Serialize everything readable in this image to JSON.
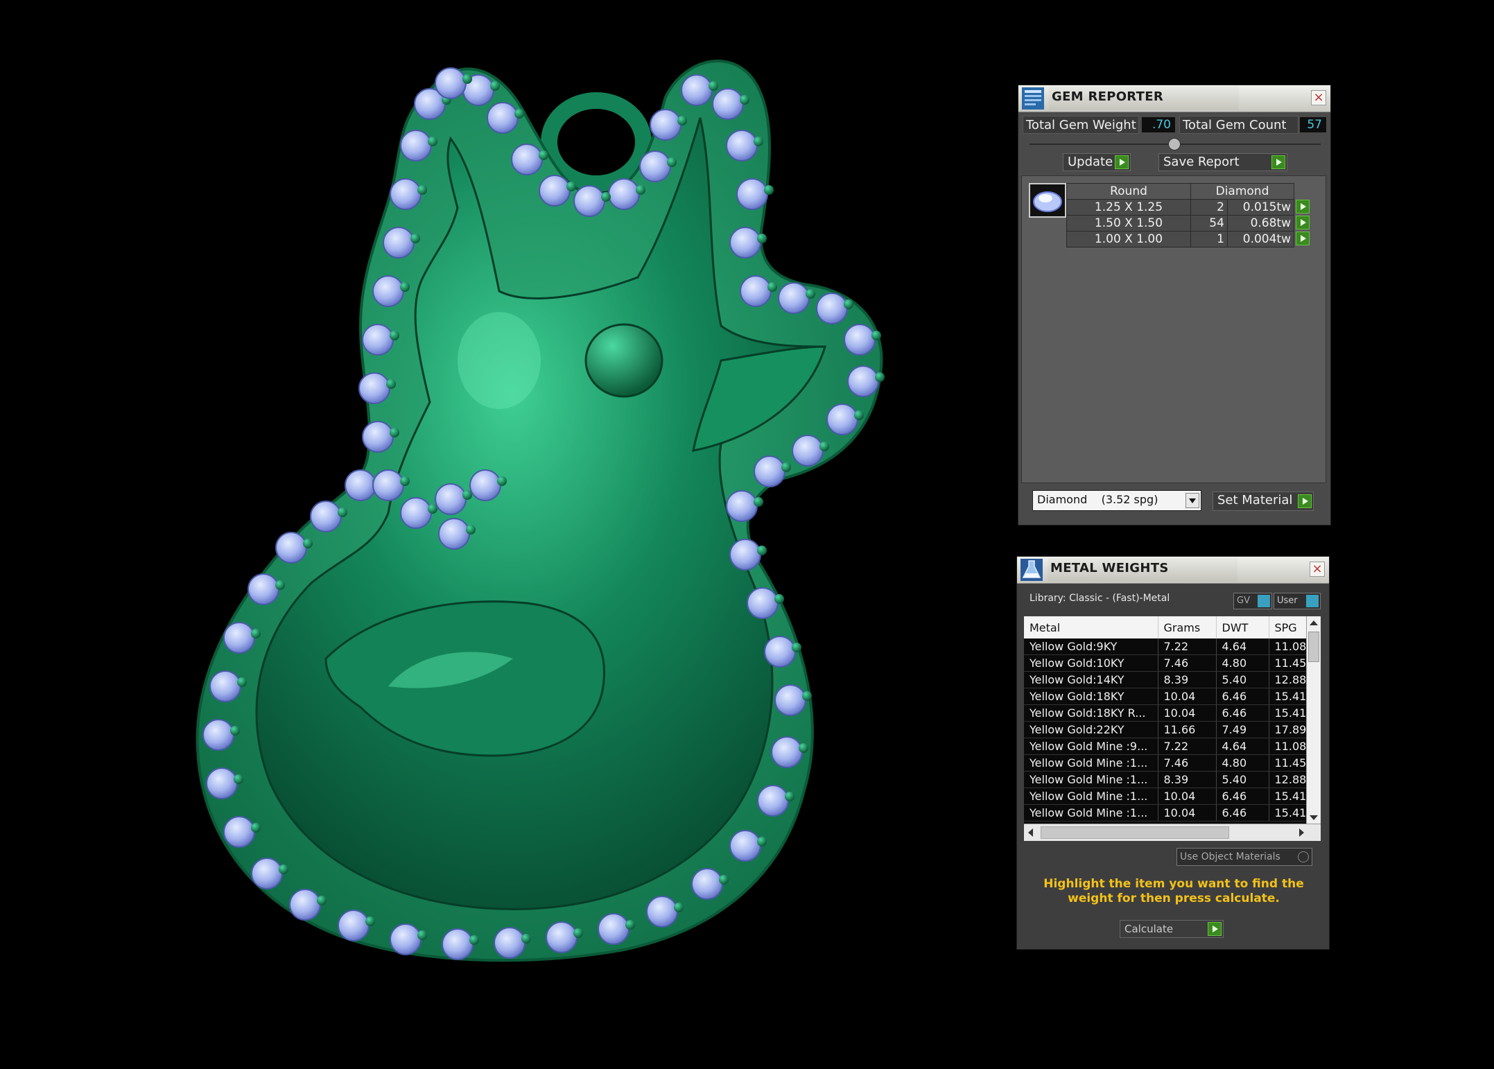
{
  "gem_reporter": {
    "title": "GEM REPORTER",
    "close_label": "×",
    "total_weight_label": "Total Gem Weight",
    "total_weight_value": ".70",
    "total_count_label": "Total Gem Count",
    "total_count_value": "57",
    "update_label": "Update",
    "save_report_label": "Save Report",
    "table": {
      "headers": [
        "Round",
        "Diamond"
      ],
      "rows": [
        {
          "size": "1.25 X 1.25",
          "count": "2",
          "weight": "0.015tw"
        },
        {
          "size": "1.50 X 1.50",
          "count": "54",
          "weight": "0.68tw"
        },
        {
          "size": "1.00 X 1.00",
          "count": "1",
          "weight": "0.004tw"
        }
      ]
    },
    "material_select": "Diamond    (3.52 spg)",
    "set_material_label": "Set Material"
  },
  "metal_weights": {
    "title": "METAL WEIGHTS",
    "close_label": "×",
    "library_label": "Library: Classic - (Fast)-Metal",
    "gv_label": "GV",
    "user_label": "User",
    "columns": [
      "Metal",
      "Grams",
      "DWT",
      "SPG"
    ],
    "rows": [
      [
        "Yellow Gold:9KY",
        "7.22",
        "4.64",
        "11.08"
      ],
      [
        "Yellow Gold:10KY",
        "7.46",
        "4.80",
        "11.45"
      ],
      [
        "Yellow Gold:14KY",
        "8.39",
        "5.40",
        "12.88"
      ],
      [
        "Yellow Gold:18KY",
        "10.04",
        "6.46",
        "15.41"
      ],
      [
        "Yellow Gold:18KY R...",
        "10.04",
        "6.46",
        "15.41"
      ],
      [
        "Yellow Gold:22KY",
        "11.66",
        "7.49",
        "17.89"
      ],
      [
        "Yellow Gold Mine :9...",
        "7.22",
        "4.64",
        "11.08"
      ],
      [
        "Yellow Gold Mine :1...",
        "7.46",
        "4.80",
        "11.45"
      ],
      [
        "Yellow Gold Mine :1...",
        "8.39",
        "5.40",
        "12.88"
      ],
      [
        "Yellow Gold Mine :1...",
        "10.04",
        "6.46",
        "15.41"
      ],
      [
        "Yellow Gold Mine :1...",
        "10.04",
        "6.46",
        "15.41"
      ]
    ],
    "use_object_materials_label": "Use Object Materials",
    "instruction": "Highlight the item you want to find the weight for then press calculate.",
    "calculate_label": "Calculate"
  },
  "colors": {
    "metal_green": "#1f8a5c",
    "gem_blue": "#a8b8f0",
    "instruction_yellow": "#f2c21a",
    "value_cyan": "#4ac8e0"
  }
}
